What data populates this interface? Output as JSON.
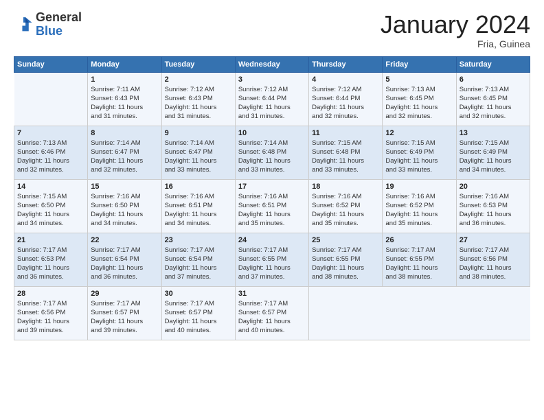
{
  "header": {
    "logo_general": "General",
    "logo_blue": "Blue",
    "month_title": "January 2024",
    "subtitle": "Fria, Guinea"
  },
  "days_of_week": [
    "Sunday",
    "Monday",
    "Tuesday",
    "Wednesday",
    "Thursday",
    "Friday",
    "Saturday"
  ],
  "weeks": [
    [
      {
        "day": "",
        "detail": ""
      },
      {
        "day": "1",
        "detail": "Sunrise: 7:11 AM\nSunset: 6:43 PM\nDaylight: 11 hours\nand 31 minutes."
      },
      {
        "day": "2",
        "detail": "Sunrise: 7:12 AM\nSunset: 6:43 PM\nDaylight: 11 hours\nand 31 minutes."
      },
      {
        "day": "3",
        "detail": "Sunrise: 7:12 AM\nSunset: 6:44 PM\nDaylight: 11 hours\nand 31 minutes."
      },
      {
        "day": "4",
        "detail": "Sunrise: 7:12 AM\nSunset: 6:44 PM\nDaylight: 11 hours\nand 32 minutes."
      },
      {
        "day": "5",
        "detail": "Sunrise: 7:13 AM\nSunset: 6:45 PM\nDaylight: 11 hours\nand 32 minutes."
      },
      {
        "day": "6",
        "detail": "Sunrise: 7:13 AM\nSunset: 6:45 PM\nDaylight: 11 hours\nand 32 minutes."
      }
    ],
    [
      {
        "day": "7",
        "detail": "Sunrise: 7:13 AM\nSunset: 6:46 PM\nDaylight: 11 hours\nand 32 minutes."
      },
      {
        "day": "8",
        "detail": "Sunrise: 7:14 AM\nSunset: 6:47 PM\nDaylight: 11 hours\nand 32 minutes."
      },
      {
        "day": "9",
        "detail": "Sunrise: 7:14 AM\nSunset: 6:47 PM\nDaylight: 11 hours\nand 33 minutes."
      },
      {
        "day": "10",
        "detail": "Sunrise: 7:14 AM\nSunset: 6:48 PM\nDaylight: 11 hours\nand 33 minutes."
      },
      {
        "day": "11",
        "detail": "Sunrise: 7:15 AM\nSunset: 6:48 PM\nDaylight: 11 hours\nand 33 minutes."
      },
      {
        "day": "12",
        "detail": "Sunrise: 7:15 AM\nSunset: 6:49 PM\nDaylight: 11 hours\nand 33 minutes."
      },
      {
        "day": "13",
        "detail": "Sunrise: 7:15 AM\nSunset: 6:49 PM\nDaylight: 11 hours\nand 34 minutes."
      }
    ],
    [
      {
        "day": "14",
        "detail": "Sunrise: 7:15 AM\nSunset: 6:50 PM\nDaylight: 11 hours\nand 34 minutes."
      },
      {
        "day": "15",
        "detail": "Sunrise: 7:16 AM\nSunset: 6:50 PM\nDaylight: 11 hours\nand 34 minutes."
      },
      {
        "day": "16",
        "detail": "Sunrise: 7:16 AM\nSunset: 6:51 PM\nDaylight: 11 hours\nand 34 minutes."
      },
      {
        "day": "17",
        "detail": "Sunrise: 7:16 AM\nSunset: 6:51 PM\nDaylight: 11 hours\nand 35 minutes."
      },
      {
        "day": "18",
        "detail": "Sunrise: 7:16 AM\nSunset: 6:52 PM\nDaylight: 11 hours\nand 35 minutes."
      },
      {
        "day": "19",
        "detail": "Sunrise: 7:16 AM\nSunset: 6:52 PM\nDaylight: 11 hours\nand 35 minutes."
      },
      {
        "day": "20",
        "detail": "Sunrise: 7:16 AM\nSunset: 6:53 PM\nDaylight: 11 hours\nand 36 minutes."
      }
    ],
    [
      {
        "day": "21",
        "detail": "Sunrise: 7:17 AM\nSunset: 6:53 PM\nDaylight: 11 hours\nand 36 minutes."
      },
      {
        "day": "22",
        "detail": "Sunrise: 7:17 AM\nSunset: 6:54 PM\nDaylight: 11 hours\nand 36 minutes."
      },
      {
        "day": "23",
        "detail": "Sunrise: 7:17 AM\nSunset: 6:54 PM\nDaylight: 11 hours\nand 37 minutes."
      },
      {
        "day": "24",
        "detail": "Sunrise: 7:17 AM\nSunset: 6:55 PM\nDaylight: 11 hours\nand 37 minutes."
      },
      {
        "day": "25",
        "detail": "Sunrise: 7:17 AM\nSunset: 6:55 PM\nDaylight: 11 hours\nand 38 minutes."
      },
      {
        "day": "26",
        "detail": "Sunrise: 7:17 AM\nSunset: 6:55 PM\nDaylight: 11 hours\nand 38 minutes."
      },
      {
        "day": "27",
        "detail": "Sunrise: 7:17 AM\nSunset: 6:56 PM\nDaylight: 11 hours\nand 38 minutes."
      }
    ],
    [
      {
        "day": "28",
        "detail": "Sunrise: 7:17 AM\nSunset: 6:56 PM\nDaylight: 11 hours\nand 39 minutes."
      },
      {
        "day": "29",
        "detail": "Sunrise: 7:17 AM\nSunset: 6:57 PM\nDaylight: 11 hours\nand 39 minutes."
      },
      {
        "day": "30",
        "detail": "Sunrise: 7:17 AM\nSunset: 6:57 PM\nDaylight: 11 hours\nand 40 minutes."
      },
      {
        "day": "31",
        "detail": "Sunrise: 7:17 AM\nSunset: 6:57 PM\nDaylight: 11 hours\nand 40 minutes."
      },
      {
        "day": "",
        "detail": ""
      },
      {
        "day": "",
        "detail": ""
      },
      {
        "day": "",
        "detail": ""
      }
    ]
  ]
}
